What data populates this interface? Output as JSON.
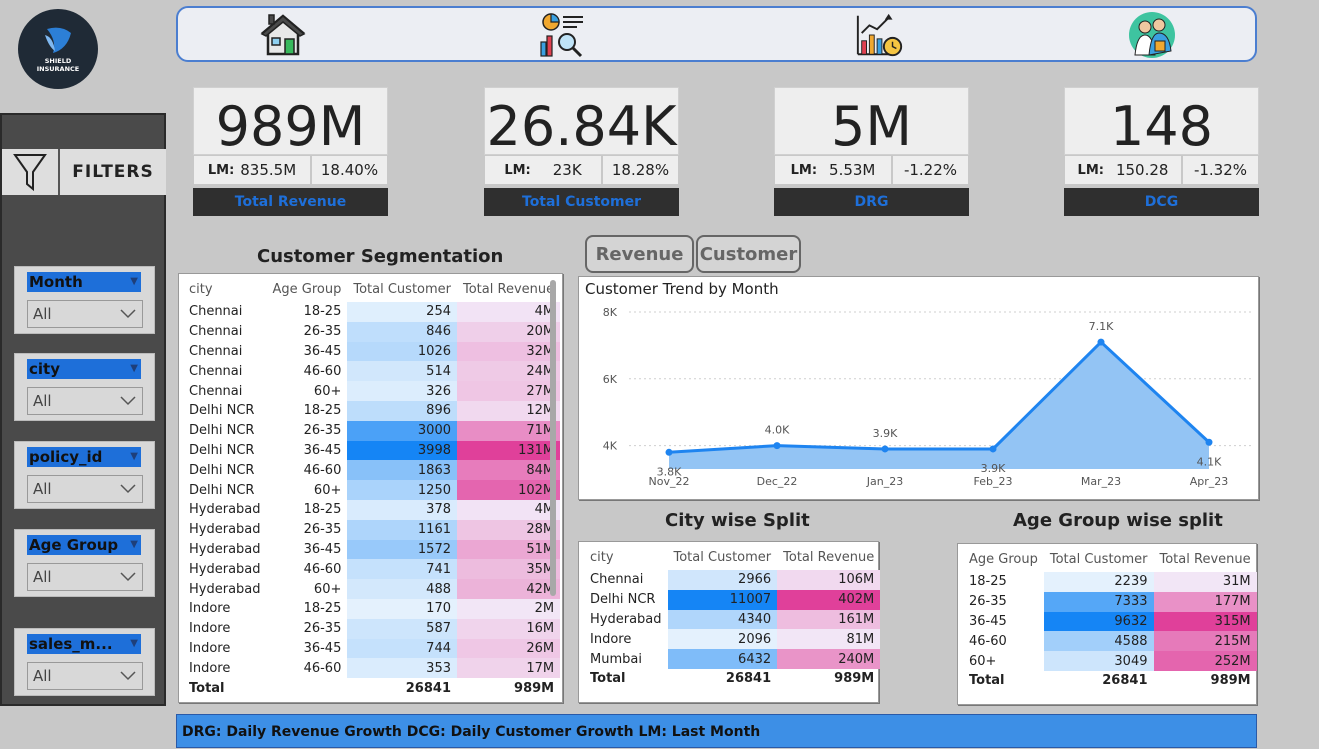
{
  "brand": {
    "logo_text_1": "SHIELD",
    "logo_text_2": "INSURANCE"
  },
  "nav": {
    "icons": [
      "home-icon",
      "analysis-report-icon",
      "growth-chart-icon",
      "team-icon"
    ]
  },
  "filters": {
    "label": "FILTERS",
    "slicers": [
      {
        "title": "Month",
        "value": "All"
      },
      {
        "title": "city",
        "value": "All"
      },
      {
        "title": "policy_id",
        "value": "All"
      },
      {
        "title": "Age Group",
        "value": "All"
      },
      {
        "title": "sales_m...",
        "value": "All"
      }
    ]
  },
  "kpis": [
    {
      "value": "989M",
      "lm_label": "LM:",
      "lm_value": "835.5M",
      "change": "18.40%",
      "label": "Total Revenue"
    },
    {
      "value": "26.84K",
      "lm_label": "LM:",
      "lm_value": "23K",
      "change": "18.28%",
      "label": "Total Customer"
    },
    {
      "value": "5M",
      "lm_label": "LM:",
      "lm_value": "5.53M",
      "change": "-1.22%",
      "label": "DRG"
    },
    {
      "value": "148",
      "lm_label": "LM:",
      "lm_value": "150.28",
      "change": "-1.32%",
      "label": "DCG"
    }
  ],
  "segmentation": {
    "title": "Customer Segmentation",
    "headers": [
      "city",
      "Age Group",
      "Total Customer",
      "Total Revenue"
    ],
    "rows": [
      [
        "Chennai",
        "18-25",
        "254",
        "4M"
      ],
      [
        "Chennai",
        "26-35",
        "846",
        "20M"
      ],
      [
        "Chennai",
        "36-45",
        "1026",
        "32M"
      ],
      [
        "Chennai",
        "46-60",
        "514",
        "24M"
      ],
      [
        "Chennai",
        "60+",
        "326",
        "27M"
      ],
      [
        "Delhi NCR",
        "18-25",
        "896",
        "12M"
      ],
      [
        "Delhi NCR",
        "26-35",
        "3000",
        "71M"
      ],
      [
        "Delhi NCR",
        "36-45",
        "3998",
        "131M"
      ],
      [
        "Delhi NCR",
        "46-60",
        "1863",
        "84M"
      ],
      [
        "Delhi NCR",
        "60+",
        "1250",
        "102M"
      ],
      [
        "Hyderabad",
        "18-25",
        "378",
        "4M"
      ],
      [
        "Hyderabad",
        "26-35",
        "1161",
        "28M"
      ],
      [
        "Hyderabad",
        "36-45",
        "1572",
        "51M"
      ],
      [
        "Hyderabad",
        "46-60",
        "741",
        "35M"
      ],
      [
        "Hyderabad",
        "60+",
        "488",
        "42M"
      ],
      [
        "Indore",
        "18-25",
        "170",
        "2M"
      ],
      [
        "Indore",
        "26-35",
        "587",
        "16M"
      ],
      [
        "Indore",
        "36-45",
        "744",
        "26M"
      ],
      [
        "Indore",
        "46-60",
        "353",
        "17M"
      ]
    ],
    "total": [
      "Total",
      "",
      "26841",
      "989M"
    ]
  },
  "toggles": {
    "revenue": "Revenue",
    "customer": "Customer"
  },
  "chart_data": {
    "type": "area",
    "title": "Customer Trend by Month",
    "categories": [
      "Nov_22",
      "Dec_22",
      "Jan_23",
      "Feb_23",
      "Mar_23",
      "Apr_23"
    ],
    "values": [
      3800,
      4000,
      3900,
      3900,
      7100,
      4100
    ],
    "data_labels": [
      "3.8K",
      "4.0K",
      "3.9K",
      "3.9K",
      "7.1K",
      "4.1K"
    ],
    "yticks": [
      "4K",
      "6K",
      "8K"
    ],
    "ytick_values": [
      4000,
      6000,
      8000
    ],
    "ylim": [
      3300,
      8000
    ],
    "grid": true,
    "colors": {
      "line": "#1e84f0",
      "fill": "#93c4f4"
    }
  },
  "city_split": {
    "title": "City wise Split",
    "headers": [
      "city",
      "Total Customer",
      "Total Revenue"
    ],
    "rows": [
      [
        "Chennai",
        "2966",
        "106M"
      ],
      [
        "Delhi NCR",
        "11007",
        "402M"
      ],
      [
        "Hyderabad",
        "4340",
        "161M"
      ],
      [
        "Indore",
        "2096",
        "81M"
      ],
      [
        "Mumbai",
        "6432",
        "240M"
      ]
    ],
    "total": [
      "Total",
      "26841",
      "989M"
    ]
  },
  "age_split": {
    "title": "Age Group wise split",
    "headers": [
      "Age Group",
      "Total Customer",
      "Total Revenue"
    ],
    "rows": [
      [
        "18-25",
        "2239",
        "31M"
      ],
      [
        "26-35",
        "7333",
        "177M"
      ],
      [
        "36-45",
        "9632",
        "315M"
      ],
      [
        "46-60",
        "4588",
        "215M"
      ],
      [
        "60+",
        "3049",
        "252M"
      ]
    ],
    "total": [
      "Total",
      "26841",
      "989M"
    ]
  },
  "footer": {
    "text": "DRG: Daily Revenue Growth  DCG: Daily Customer Growth  LM: Last Month"
  },
  "colors": {
    "accent": "#1e6fd9",
    "customer_scale": [
      "#e4f1fd",
      "#1585f5"
    ],
    "revenue_scale": [
      "#f2e6f6",
      "#e0409a"
    ]
  }
}
